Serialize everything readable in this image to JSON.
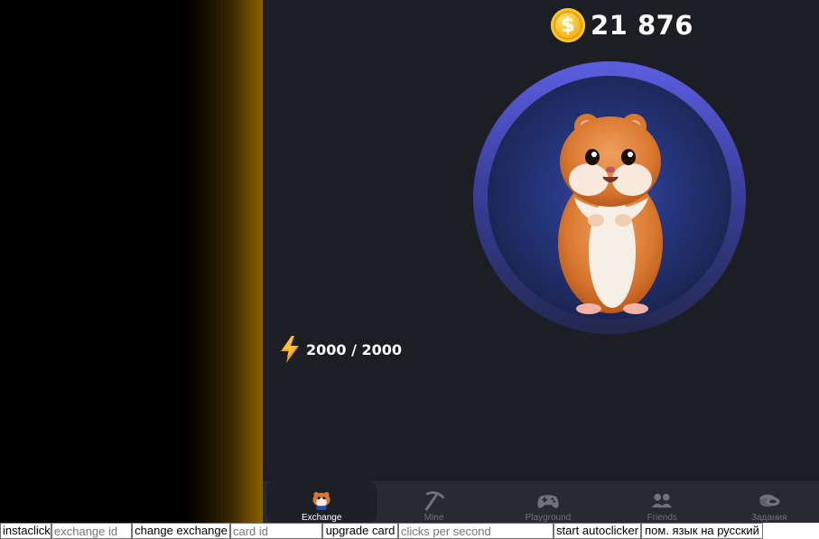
{
  "game": {
    "balance": "21 876",
    "coin_symbol": "$",
    "energy": "2000 / 2000"
  },
  "nav": {
    "items": [
      {
        "label": "Exchange",
        "icon": "hamster-icon",
        "active": true
      },
      {
        "label": "Mine",
        "icon": "pickaxe-icon",
        "active": false
      },
      {
        "label": "Playground",
        "icon": "gamepad-icon",
        "active": false
      },
      {
        "label": "Friends",
        "icon": "friends-icon",
        "active": false
      },
      {
        "label": "Задания",
        "icon": "coins-icon",
        "active": false
      }
    ]
  },
  "toolbar": {
    "instaclick_label": "instaclick",
    "exchange_id_placeholder": "exchange id",
    "change_exchange_label": "change exchange",
    "card_id_placeholder": "card id",
    "upgrade_card_label": "upgrade card",
    "clicks_per_second_placeholder": "clicks per second",
    "start_autoclicker_label": "start autoclicker",
    "russian_label": "пом. язык на русский"
  },
  "colors": {
    "background": "#1c1e23",
    "navbar": "#272a2f",
    "coin": "#f6b81a",
    "ring": "#5b5fe0"
  }
}
